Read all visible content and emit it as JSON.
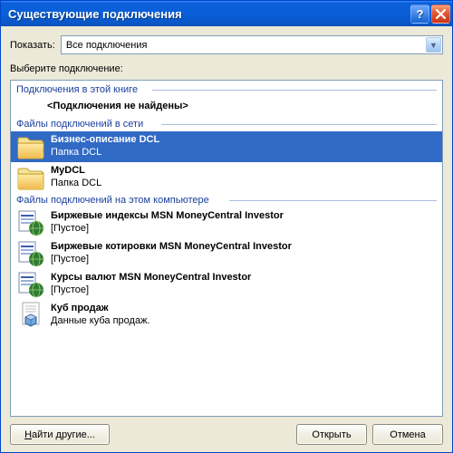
{
  "window": {
    "title": "Существующие подключения"
  },
  "show": {
    "label": "Показать:",
    "value": "Все подключения"
  },
  "selectLabel": "Выберите подключение:",
  "groups": {
    "inBook": {
      "header": "Подключения в этой книге",
      "empty": "<Подключения не найдены>"
    },
    "network": {
      "header": "Файлы подключений в сети",
      "items": [
        {
          "title": "Бизнес-описание DCL",
          "sub": "Папка DCL"
        },
        {
          "title": "MyDCL",
          "sub": "Папка DCL"
        }
      ]
    },
    "local": {
      "header": "Файлы подключений на этом компьютере",
      "items": [
        {
          "title": "Биржевые индексы MSN MoneyCentral Investor",
          "sub": "[Пустое]"
        },
        {
          "title": "Биржевые котировки MSN MoneyCentral Investor",
          "sub": "[Пустое]"
        },
        {
          "title": "Курсы валют MSN MoneyCentral Investor",
          "sub": "[Пустое]"
        },
        {
          "title": "Куб продаж",
          "sub": "Данные куба продаж."
        }
      ]
    }
  },
  "buttons": {
    "findOtherPrefix": "Н",
    "findOtherRest": "айти другие...",
    "open": "Открыть",
    "cancel": "Отмена"
  }
}
